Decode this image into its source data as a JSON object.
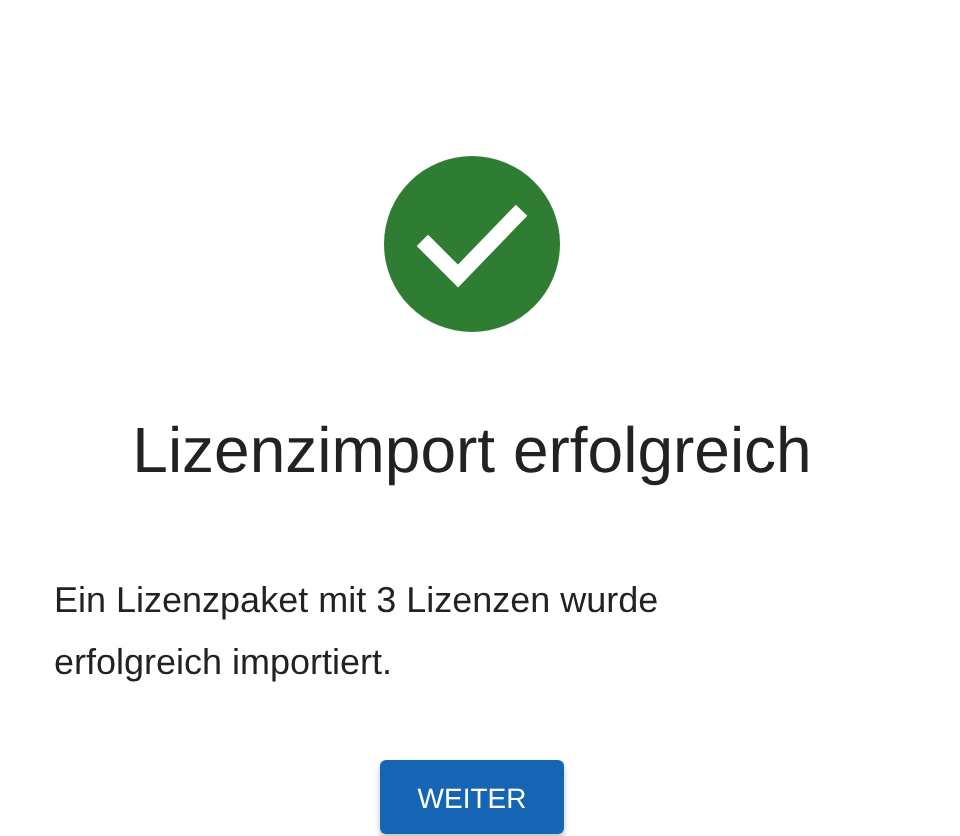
{
  "title": "Lizenzimport erfolgreich",
  "message": "Ein Lizenzpaket mit 3 Lizenzen wurde erfolgreich importiert.",
  "button": {
    "label": "WEITER"
  }
}
